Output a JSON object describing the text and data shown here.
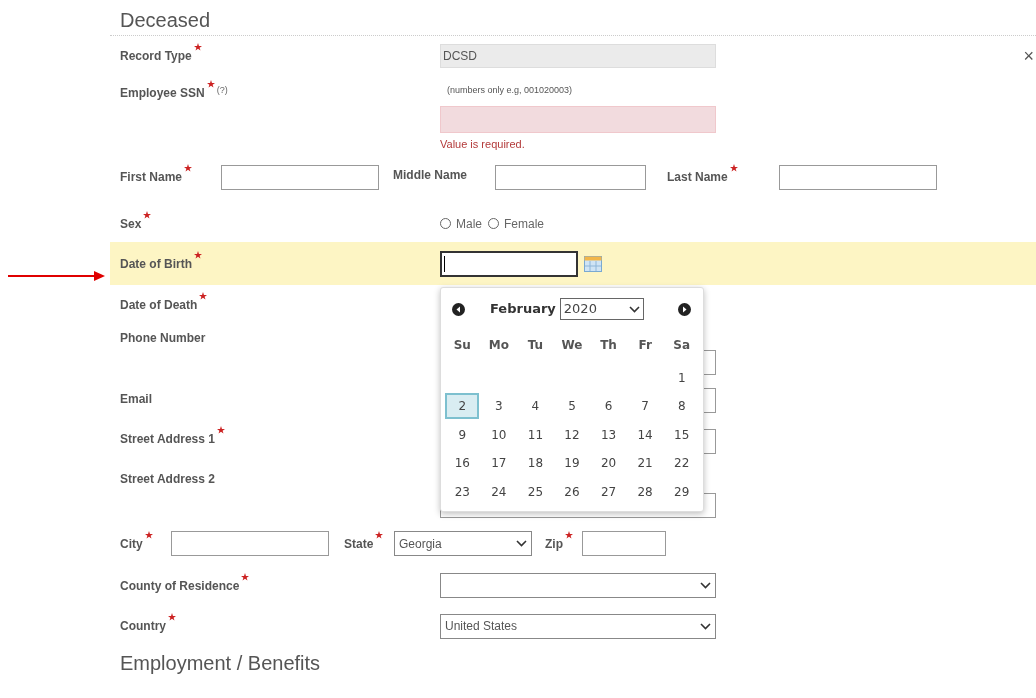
{
  "section_title": "Deceased",
  "close": "×",
  "record_type": {
    "label": "Record Type",
    "required": true,
    "value": "DCSD"
  },
  "employee_ssn": {
    "label": "Employee SSN",
    "required": true,
    "help": "(?)",
    "hint": "(numbers only e.g, 001020003)",
    "invalid": true,
    "error": "Value is required."
  },
  "name_fields": [
    {
      "label": "First Name",
      "required": true
    },
    {
      "label": "Middle Name",
      "required": false
    },
    {
      "label": "Last Name",
      "required": true
    }
  ],
  "sex": {
    "label": "Sex",
    "required": true,
    "options": [
      {
        "label": "Male",
        "selected": false
      },
      {
        "label": "Female",
        "selected": false
      }
    ]
  },
  "date_of_birth": {
    "label": "Date of Birth",
    "required": true,
    "highlighted": true
  },
  "date_of_death": {
    "label": "Date of Death",
    "required": true
  },
  "contact_fields": [
    {
      "label": "Phone Number",
      "required": false
    },
    {
      "label": "Email",
      "required": false
    },
    {
      "label": "Street Address 1",
      "required": true
    },
    {
      "label": "Street Address 2",
      "required": false
    }
  ],
  "address_row": [
    {
      "kind": "text",
      "label": "City",
      "required": true
    },
    {
      "kind": "select",
      "label": "State",
      "required": true,
      "value": "Georgia"
    },
    {
      "kind": "text",
      "label": "Zip",
      "required": true
    }
  ],
  "county": {
    "label": "County of Residence",
    "required": true
  },
  "country": {
    "label": "Country",
    "required": true,
    "value": "United States"
  },
  "calendar": {
    "month": "February",
    "year": "2020",
    "weekdays": [
      "Su",
      "Mo",
      "Tu",
      "We",
      "Th",
      "Fr",
      "Sa"
    ],
    "weeks": [
      [
        {
          "day": "1",
          "selected": false
        }
      ],
      [
        {
          "day": "2",
          "selected": true
        },
        {
          "day": "3",
          "selected": false
        },
        {
          "day": "4",
          "selected": false
        },
        {
          "day": "5",
          "selected": false
        },
        {
          "day": "6",
          "selected": false
        },
        {
          "day": "7",
          "selected": false
        },
        {
          "day": "8",
          "selected": false
        }
      ],
      [
        {
          "day": "9",
          "selected": false
        },
        {
          "day": "10",
          "selected": false
        },
        {
          "day": "11",
          "selected": false
        },
        {
          "day": "12",
          "selected": false
        },
        {
          "day": "13",
          "selected": false
        },
        {
          "day": "14",
          "selected": false
        },
        {
          "day": "15",
          "selected": false
        }
      ],
      [
        {
          "day": "16",
          "selected": false
        },
        {
          "day": "17",
          "selected": false
        },
        {
          "day": "18",
          "selected": false
        },
        {
          "day": "19",
          "selected": false
        },
        {
          "day": "20",
          "selected": false
        },
        {
          "day": "21",
          "selected": false
        },
        {
          "day": "22",
          "selected": false
        }
      ],
      [
        {
          "day": "23",
          "selected": false
        },
        {
          "day": "24",
          "selected": false
        },
        {
          "day": "25",
          "selected": false
        },
        {
          "day": "26",
          "selected": false
        },
        {
          "day": "27",
          "selected": false
        },
        {
          "day": "28",
          "selected": false
        },
        {
          "day": "29",
          "selected": false
        }
      ]
    ]
  },
  "next_section_title": "Employment / Benefits"
}
